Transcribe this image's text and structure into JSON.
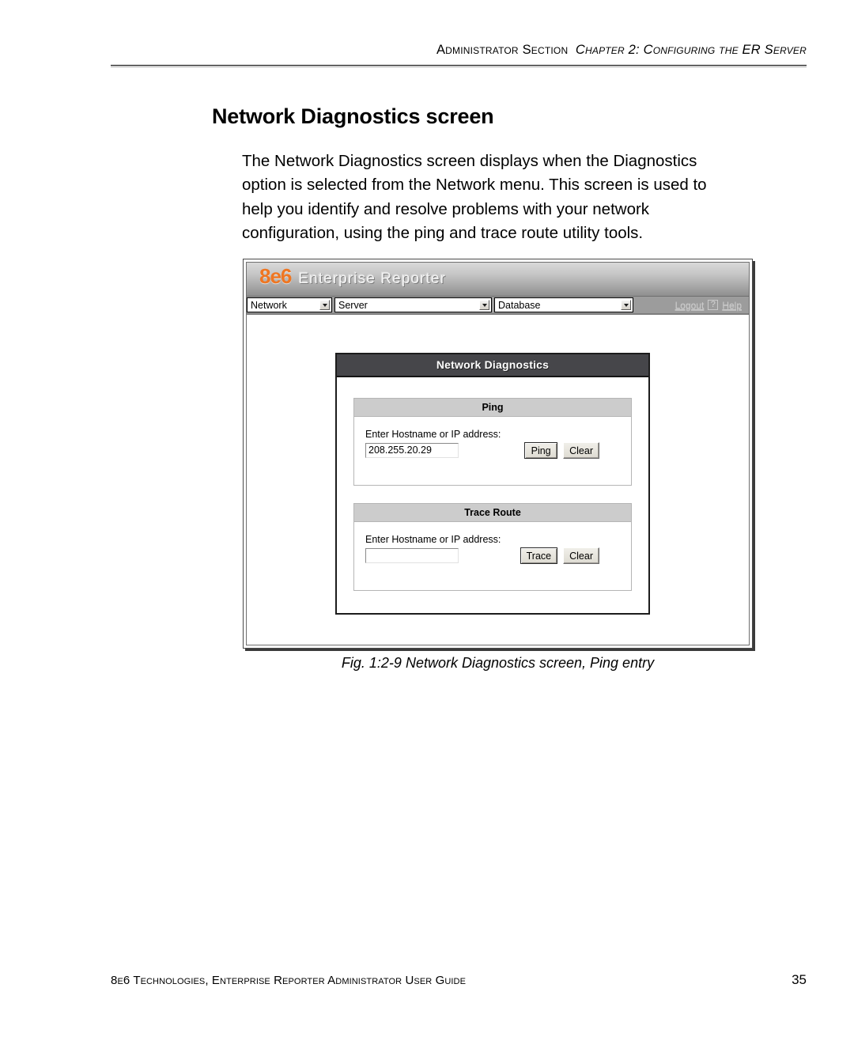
{
  "page": {
    "running_header": {
      "section": "Administrator Section",
      "chapter": "Chapter 2: Configuring the ER Server"
    },
    "title": "Network Diagnostics screen",
    "body_paragraph": "The Network Diagnostics screen displays when the Diagnostics option is selected from the Network menu. This screen is used to help you identify and resolve problems with your network configuration, using the ping and trace route utility tools.",
    "figure_caption": "Fig. 1:2-9  Network Diagnostics screen, Ping entry",
    "footer": {
      "text": "8e6 Technologies, Enterprise Reporter Administrator User Guide",
      "page_number": "35"
    }
  },
  "screenshot": {
    "banner": {
      "logo_mark": "8e6",
      "logo_text": "Enterprise Reporter"
    },
    "menu_bar": {
      "selects": [
        {
          "name": "network",
          "value": "Network",
          "icon": "chevron-down-icon"
        },
        {
          "name": "server",
          "value": "Server",
          "icon": "chevron-down-icon"
        },
        {
          "name": "database",
          "value": "Database",
          "icon": "chevron-down-icon"
        }
      ],
      "logout_label": "Logout",
      "help_badge": "?",
      "help_label": "Help"
    },
    "panel": {
      "title": "Network Diagnostics",
      "groups": [
        {
          "name": "ping",
          "header": "Ping",
          "field_label": "Enter Hostname or IP address:",
          "field_value": "208.255.20.29",
          "field_placeholder": "",
          "submit_label": "Ping",
          "clear_label": "Clear"
        },
        {
          "name": "trace-route",
          "header": "Trace Route",
          "field_label": "Enter Hostname or IP address:",
          "field_value": "",
          "field_placeholder": "",
          "submit_label": "Trace",
          "clear_label": "Clear"
        }
      ]
    }
  },
  "colors": {
    "logo_orange": "#ef7622",
    "panel_title_bg": "#46464a",
    "group_header_bg": "#cccccc",
    "menu_bar_bg": "#9c9c9c"
  }
}
